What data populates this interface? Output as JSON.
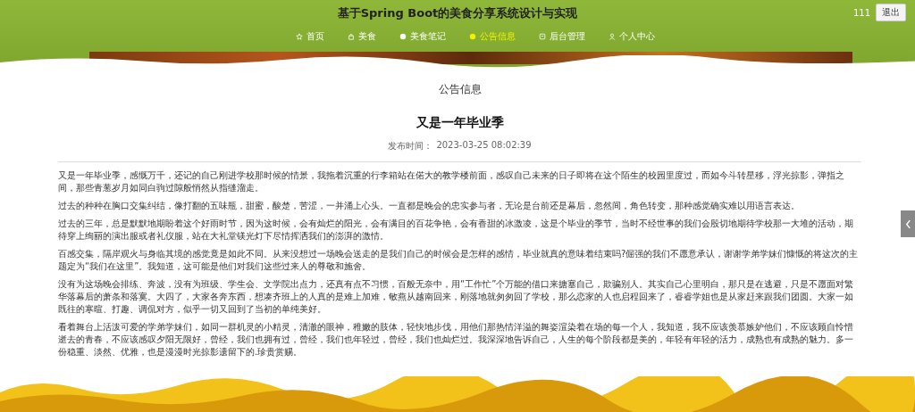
{
  "header": {
    "title": "基于Spring Boot的美食分享系统设计与实现",
    "username": "111",
    "logout_button": "退出"
  },
  "nav": [
    {
      "label": "首页",
      "kind": "star",
      "selected": false
    },
    {
      "label": "美食",
      "kind": "bag",
      "selected": false
    },
    {
      "label": "美食笔记",
      "kind": "dot",
      "selected": false
    },
    {
      "label": "公告信息",
      "kind": "dot",
      "selected": true
    },
    {
      "label": "后台管理",
      "kind": "box",
      "selected": false
    },
    {
      "label": "个人中心",
      "kind": "person",
      "selected": false
    }
  ],
  "section_title": "公告信息",
  "article": {
    "title": "又是一年毕业季",
    "publish_label": "发布时间：",
    "publish_time": "2023-03-25 08:02:39",
    "paragraphs": [
      "又是一年毕业季，感慨万千，还记的自己刚进学校那时候的情景，我拖着沉重的行李箱站在偌大的教学楼前面，感叹自己未来的日子即将在这个陌生的校园里度过，而如今斗转星移，浮光掠影，弹指之间，那些青葱岁月如同白驹过隙般悄然从指缝溜走。",
      "过去的种种在胸口交集纠结，像打翻的五味瓶，甜蜜，酸楚，苦涩，一并涌上心头。一直都是晚会的忠实参与者，无论是台前还是幕后，忽然间，角色转变，那种感觉确实难以用语言表达。",
      "过去的三年，总是默默地期盼着这个好雨时节，因为这时候，会有灿烂的阳光，会有满目的百花争艳，会有香甜的冰激凌，这是个毕业的季节，当时不经世事的我们会殷切地期待学校那一大堆的活动，期待穿上绚丽的演出服或者礼仪服，站在大礼堂镁光灯下尽情挥洒我们的澎湃的激情。",
      "百感交集，隔岸观火与身临其境的感觉竟是如此不同。从来没想过一场晚会送走的是我们自己的时候会是怎样的感情，毕业就真的意味着结束吗?倔强的我们不愿意承认，谢谢学弟学妹们慷慨的将这次的主题定为“我们在这里”。我知道，这可能是他们对我们这些过来人的尊敬和施舍。",
      "没有为这场晚会排练、奔波，没有为班级、学生会、文学院出点力，还真有点不习惯，百般无奈中，用“工作忙”个万能的借口来搪塞自己，欺骗别人。其实自己心里明白，那只是在逃避，只是不愿面对繁华落幕后的萧条和落寞。大四了，大家各奔东西，想凑齐班上的人真的是难上加难，敏燕从越南回来，刚落地就匆匆回了学校，那么恋家的人也启程回来了，睿睿学姐也是从家赶来跟我们团圆。大家一如既往的寒暄、打趣、调侃对方，似乎一切又回到了当初的单纯美好。",
      "看着舞台上活泼可爱的学弟学妹们，如同一群机灵的小精灵，清澈的眼神，稚嫩的肢体，轻快地步伐，用他们那热情洋溢的舞姿渲染着在场的每一个人，我知道，我不应该羡慕嫉妒他们，不应该顾自怜惜逝去的青春，不应该感叹夕阳无限好，曾经，我们也拥有过，曾经，我们也年轻过，曾经，我们也灿烂过。我深深地告诉自己，人生的每个阶段都是美的，年轻有年轻的活力，成熟也有成熟的魅力。多一份稳重、淡然、优雅，也是漫漫时光掠影遗留下的.珍贵赏赐。"
    ]
  }
}
